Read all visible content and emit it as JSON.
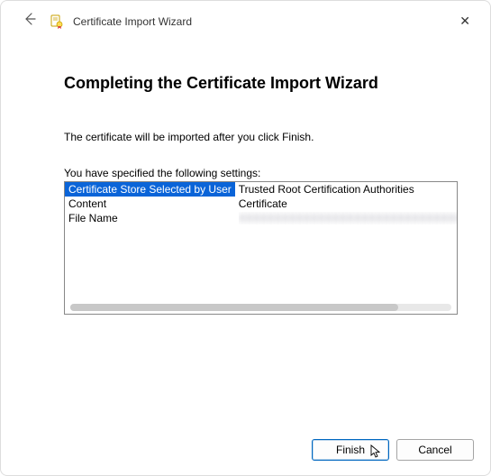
{
  "header": {
    "wizard_title": "Certificate Import Wizard"
  },
  "main": {
    "heading": "Completing the Certificate Import Wizard",
    "description": "The certificate will be imported after you click Finish.",
    "settings_label": "You have specified the following settings:",
    "rows": [
      {
        "label": "Certificate Store Selected by User",
        "value": "Trusted Root Certification Authorities"
      },
      {
        "label": "Content",
        "value": "Certificate"
      },
      {
        "label": "File Name",
        "value": "XXXXXXXXXXXXXXXXXXXXXXXXXXXXXXXXXXXX"
      }
    ]
  },
  "footer": {
    "finish_label": "Finish",
    "cancel_label": "Cancel"
  }
}
